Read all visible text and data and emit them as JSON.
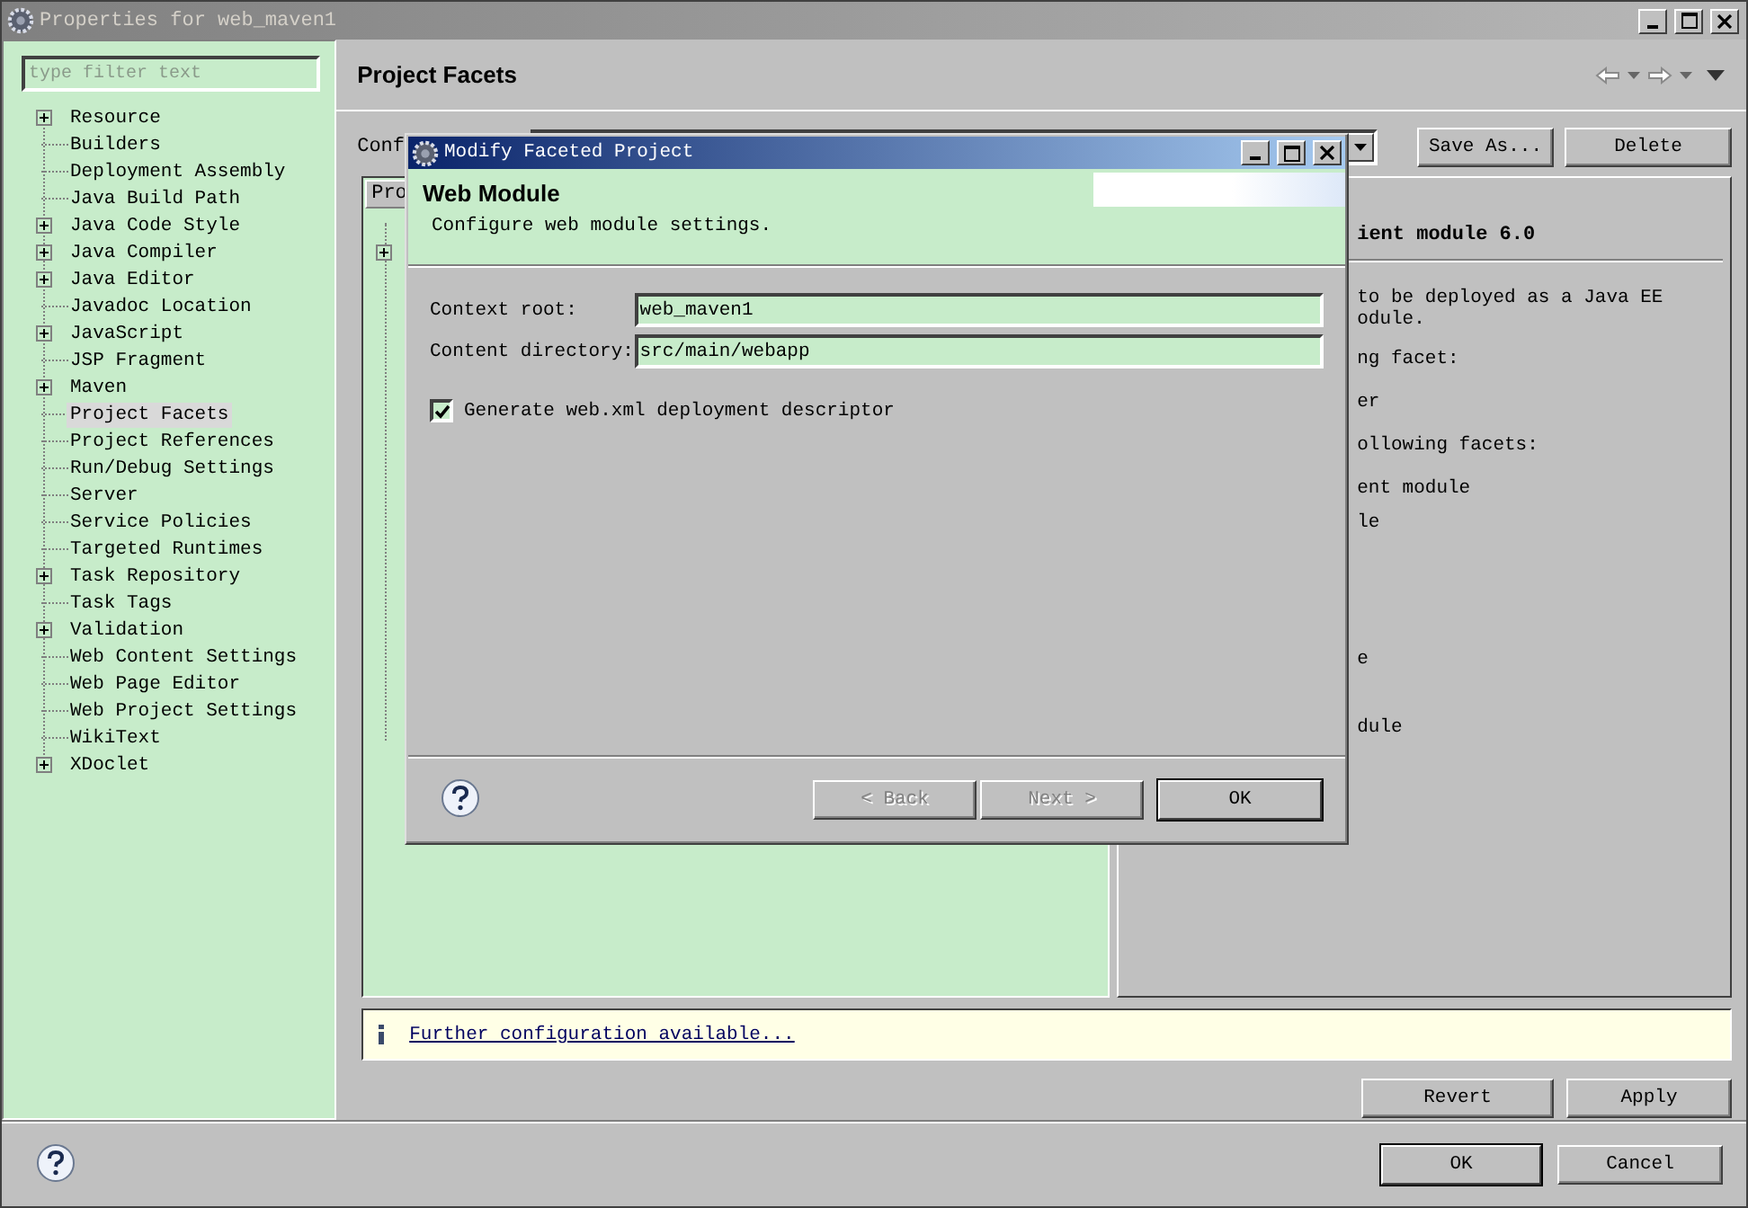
{
  "window": {
    "title": "Properties for web_maven1"
  },
  "sidebar": {
    "filter": {
      "placeholder": "type filter text"
    },
    "items": [
      {
        "label": "Resource",
        "expandable": true,
        "selected": false
      },
      {
        "label": "Builders",
        "expandable": false,
        "selected": false
      },
      {
        "label": "Deployment Assembly",
        "expandable": false,
        "selected": false
      },
      {
        "label": "Java Build Path",
        "expandable": false,
        "selected": false
      },
      {
        "label": "Java Code Style",
        "expandable": true,
        "selected": false
      },
      {
        "label": "Java Compiler",
        "expandable": true,
        "selected": false
      },
      {
        "label": "Java Editor",
        "expandable": true,
        "selected": false
      },
      {
        "label": "Javadoc Location",
        "expandable": false,
        "selected": false
      },
      {
        "label": "JavaScript",
        "expandable": true,
        "selected": false
      },
      {
        "label": "JSP Fragment",
        "expandable": false,
        "selected": false
      },
      {
        "label": "Maven",
        "expandable": true,
        "selected": false
      },
      {
        "label": "Project Facets",
        "expandable": false,
        "selected": true
      },
      {
        "label": "Project References",
        "expandable": false,
        "selected": false
      },
      {
        "label": "Run/Debug Settings",
        "expandable": false,
        "selected": false
      },
      {
        "label": "Server",
        "expandable": false,
        "selected": false
      },
      {
        "label": "Service Policies",
        "expandable": false,
        "selected": false
      },
      {
        "label": "Targeted Runtimes",
        "expandable": false,
        "selected": false
      },
      {
        "label": "Task Repository",
        "expandable": true,
        "selected": false
      },
      {
        "label": "Task Tags",
        "expandable": false,
        "selected": false
      },
      {
        "label": "Validation",
        "expandable": true,
        "selected": false
      },
      {
        "label": "Web Content Settings",
        "expandable": false,
        "selected": false
      },
      {
        "label": "Web Page Editor",
        "expandable": false,
        "selected": false
      },
      {
        "label": "Web Project Settings",
        "expandable": false,
        "selected": false
      },
      {
        "label": "WikiText",
        "expandable": false,
        "selected": false
      },
      {
        "label": "XDoclet",
        "expandable": true,
        "selected": false
      }
    ]
  },
  "page": {
    "title": "Project Facets",
    "configuration_label": "Conf",
    "buttons": [
      "Save As...",
      "Delete"
    ],
    "facets_tab": "Pro",
    "details": {
      "title": "ient module 6.0",
      "lines": [
        "to be deployed as a Java EE",
        "odule.",
        "ng facet:",
        "er",
        "ollowing facets:",
        "ent module",
        "le",
        "e",
        "dule"
      ]
    },
    "info": {
      "link": "Further configuration available..."
    },
    "actions": [
      "Revert",
      "Apply"
    ]
  },
  "footer": {
    "buttons": [
      "OK",
      "Cancel"
    ]
  },
  "dialog": {
    "title": "Modify Faceted Project",
    "header": {
      "title": "Web Module",
      "subtitle": "Configure web module settings."
    },
    "fields": [
      {
        "label": "Context root:",
        "value": "web_maven1"
      },
      {
        "label": "Content directory:",
        "value": "src/main/webapp"
      }
    ],
    "checkbox": {
      "label": "Generate web.xml deployment descriptor",
      "checked": true
    },
    "buttons": [
      {
        "label": "< Back",
        "disabled": true
      },
      {
        "label": "Next >",
        "disabled": true
      },
      {
        "label": "OK",
        "disabled": false
      }
    ]
  }
}
